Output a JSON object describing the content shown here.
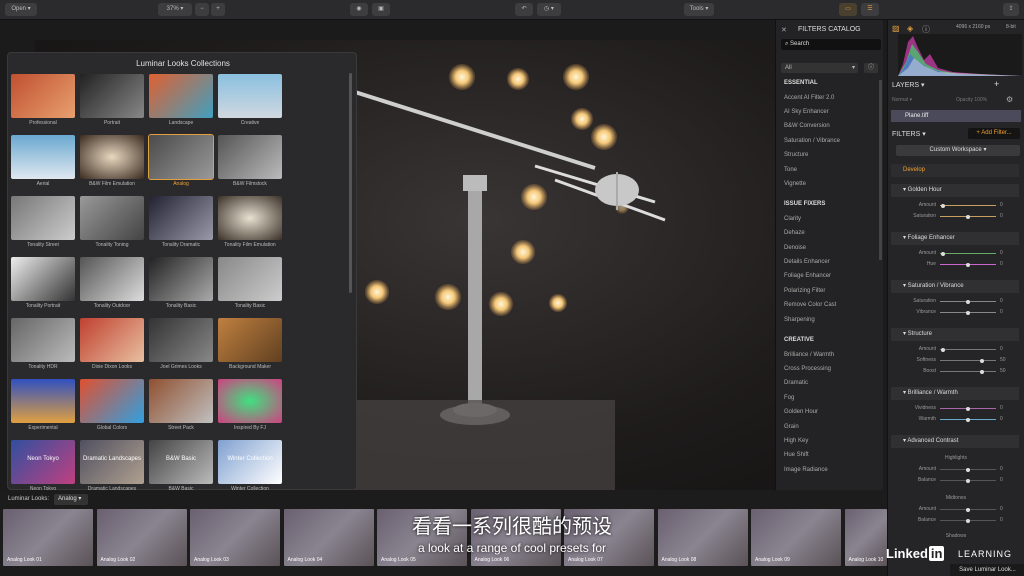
{
  "toolbar": {
    "open": "Open",
    "zoom": "37%",
    "minus": "−",
    "plus": "+",
    "tools": "Tools"
  },
  "looks": {
    "title": "Luminar Looks Collections",
    "items": [
      "Professional",
      "Portrait",
      "Landscape",
      "Creative",
      "Aerial",
      "B&W Film Emulation",
      "Analog",
      "B&W Filmstock",
      "Tonality Street",
      "Tonality Toning",
      "Tonality Dramatic",
      "Tonality Film Emulation",
      "Tonality Portrait",
      "Tonality Outdoor",
      "Tonality Basic",
      "Tonality Basic",
      "Tonality HDR",
      "Dixie Dixon Looks",
      "Joel Grimes Looks",
      "Background Maker",
      "Experimental",
      "Global Colors",
      "Street Pack",
      "Inspired By FJ",
      "Neon Tokyo",
      "Dramatic Landscapes",
      "B&W Basic",
      "Winter Collection"
    ],
    "selected": "Analog",
    "tile_texts": [
      "Neon Tokyo",
      "Dramatic Landscapes",
      "B&W Basic",
      "Winter Collection"
    ]
  },
  "catalog": {
    "title": "FILTERS CATALOG",
    "search": "Search",
    "filter": "All",
    "sections": [
      {
        "name": "ESSENTIAL",
        "items": [
          "Accent AI Filter 2.0",
          "AI Sky Enhancer",
          "B&W Conversion",
          "Saturation / Vibrance",
          "Structure",
          "Tone",
          "Vignette"
        ]
      },
      {
        "name": "ISSUE FIXERS",
        "items": [
          "Clarity",
          "Dehaze",
          "Denoise",
          "Details Enhancer",
          "Foliage Enhancer",
          "Polarizing Filter",
          "Remove Color Cast",
          "Sharpening"
        ]
      },
      {
        "name": "CREATIVE",
        "items": [
          "Brilliance / Warmth",
          "Cross Processing",
          "Dramatic",
          "Fog",
          "Golden Hour",
          "Grain",
          "High Key",
          "Hue Shift",
          "Image Radiance"
        ]
      }
    ]
  },
  "info": {
    "dims": "4096 x 2160 px",
    "bits": "8-bit"
  },
  "layers": {
    "title": "LAYERS",
    "blend": "Normal",
    "opacity": "Opacity 100%",
    "layer": "Plane.tiff"
  },
  "filters": {
    "title": "FILTERS",
    "add": "+ Add Filter...",
    "workspace": "Custom Workspace",
    "develop": "Develop",
    "golden": {
      "title": "Golden Hour",
      "r1": "Amount",
      "v1": "0",
      "r2": "Saturation",
      "v2": "0"
    },
    "foliage": {
      "title": "Foliage Enhancer",
      "r1": "Amount",
      "v1": "0",
      "r2": "Hue",
      "v2": "0"
    },
    "satvib": {
      "title": "Saturation / Vibrance",
      "r1": "Saturation",
      "v1": "0",
      "r2": "Vibrance",
      "v2": "0"
    },
    "structure": {
      "title": "Structure",
      "r1": "Amount",
      "v1": "0",
      "r2": "Softness",
      "v2": "50",
      "r3": "Boost",
      "v3": "50"
    },
    "brilliance": {
      "title": "Brilliance / Warmth",
      "r1": "Vividness",
      "v1": "0",
      "r2": "Warmth",
      "v2": "0"
    },
    "advanced": {
      "title": "Advanced Contrast",
      "g1": "Highlights",
      "r1": "Amount",
      "v1": "0",
      "r2": "Balance",
      "v2": "0",
      "g2": "Midtones",
      "r3": "Amount",
      "v3": "0",
      "r4": "Balance",
      "v4": "0",
      "g3": "Shadows"
    }
  },
  "strip": {
    "label": "Luminar Looks:",
    "value": "Analog",
    "thumbs": [
      "Analog Look 01",
      "Analog Look 02",
      "Analog Look 03",
      "Analog Look 04",
      "Analog Look 05",
      "Analog Look 06",
      "Analog Look 07",
      "Analog Look 08",
      "Analog Look 09",
      "Analog Look 10"
    ]
  },
  "subtitle": {
    "cn": "看看一系列很酷的预设",
    "en": "a look at a range of cool presets for"
  },
  "watermark": {
    "brand": "Linked",
    "in": "in",
    "learning": "LEARNING"
  },
  "save_looks": "Save Luminar Look..."
}
